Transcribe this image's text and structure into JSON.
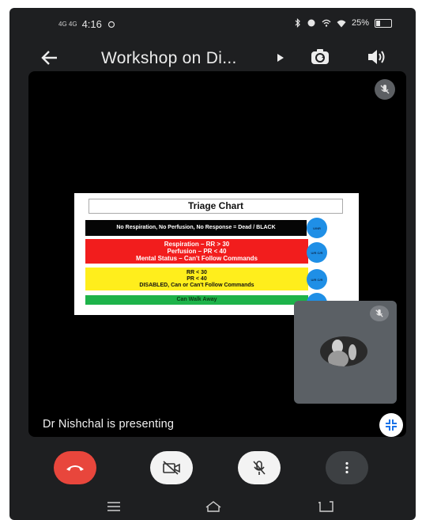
{
  "status_bar": {
    "signal_left": "4G 4G",
    "time": "4:16",
    "battery_percent": "25%"
  },
  "header": {
    "title": "Workshop on Di...",
    "back_icon": "arrow-left-icon",
    "play_icon": "play-triangle-icon",
    "camera_switch_icon": "camera-switch-icon",
    "speaker_icon": "speaker-icon"
  },
  "slide": {
    "title": "Triage Chart",
    "bands": [
      {
        "text": "No Respiration, No Perfusion, No Response = Dead / BLACK",
        "color": "#050505",
        "tag": "U/NR"
      },
      {
        "text": "Respiration – RR > 30\nPerfusion – PR < 40\nMental Status – Can't Follow Commands",
        "color": "#f21d1d",
        "tag": "U/R C/R"
      },
      {
        "text": "RR < 30\nPR < 40\nDISABLED, Can or Can't Follow Commands",
        "color": "#ffee1c",
        "tag": "U/R C/R"
      },
      {
        "text": "Can Walk Away",
        "color": "#1db34a",
        "tag": ""
      }
    ]
  },
  "presenter_text": "Dr Nishchal is presenting",
  "controls": {
    "end_call_color": "#e8463c",
    "end_call_icon": "phone-hangup-icon",
    "video_icon": "video-off-icon",
    "mic_icon": "mic-off-icon",
    "more_icon": "more-vertical-icon"
  },
  "navbar": {
    "recents_icon": "recents-icon",
    "home_icon": "home-icon",
    "back_icon": "back-nav-icon"
  }
}
